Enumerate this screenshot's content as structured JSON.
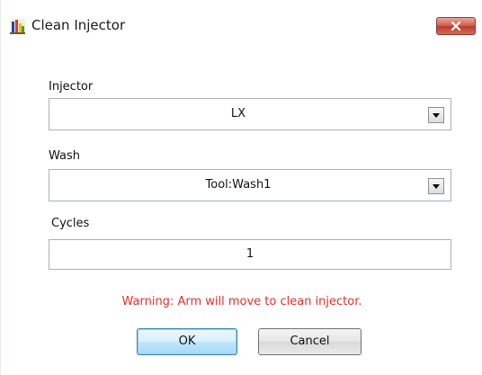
{
  "window": {
    "title": "Clean Injector",
    "icon": "chart-app-icon",
    "close_icon": "close-icon"
  },
  "form": {
    "injector": {
      "label": "Injector",
      "value": "LX"
    },
    "wash": {
      "label": "Wash",
      "value": "Tool:Wash1"
    },
    "cycles": {
      "label": "Cycles",
      "value": "1"
    },
    "warning": "Warning: Arm will move to clean injector."
  },
  "buttons": {
    "ok": "OK",
    "cancel": "Cancel"
  },
  "colors": {
    "warning": "#e0312a",
    "close_button": "#c9503e",
    "ok_border": "#3c7fb1"
  }
}
